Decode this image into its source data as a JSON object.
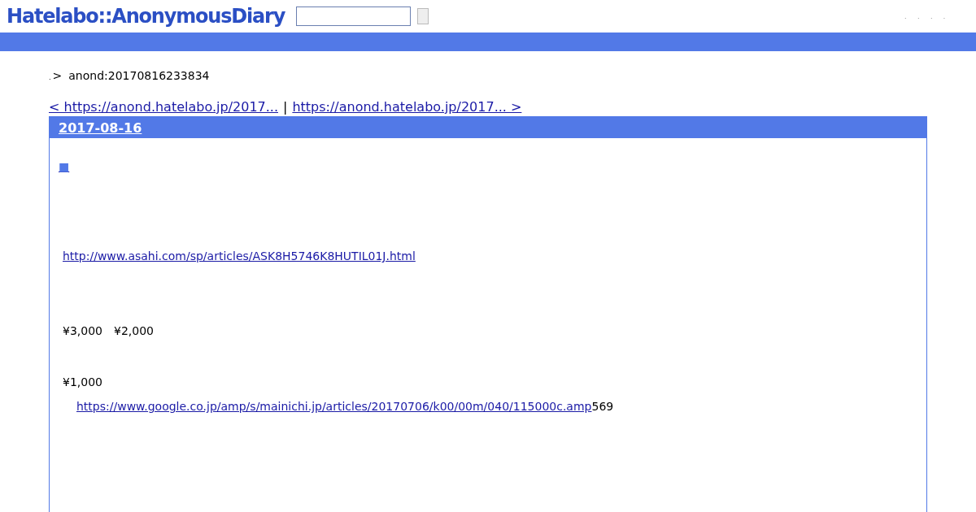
{
  "header": {
    "logo": "Hatelabo::AnonymousDiary",
    "nav_links": [
      ".",
      ".",
      ".",
      "."
    ]
  },
  "breadcrumb": {
    "home": ".",
    "separator": ">",
    "current": "anond:20170816233834"
  },
  "pager": {
    "prev": "< https://anond.hatelabo.jp/2017...",
    "separator": "|",
    "next": "https://anond.hatelabo.jp/2017... >"
  },
  "section": {
    "date": "2017-08-16",
    "anchor": "■",
    "paragraphs": [
      {
        "kind": "link",
        "link": "http://www.asahi.com/sp/articles/ASK8H5746K8HUTIL01J.html"
      },
      {
        "kind": "text",
        "text": "¥3,000　¥2,000"
      },
      {
        "kind": "text",
        "text": "¥1,000"
      },
      {
        "kind": "linktext",
        "link": "https://www.google.co.jp/amp/s/mainichi.jp/articles/20170706/k00/00m/040/115000c.amp",
        "text": "569"
      }
    ]
  }
}
